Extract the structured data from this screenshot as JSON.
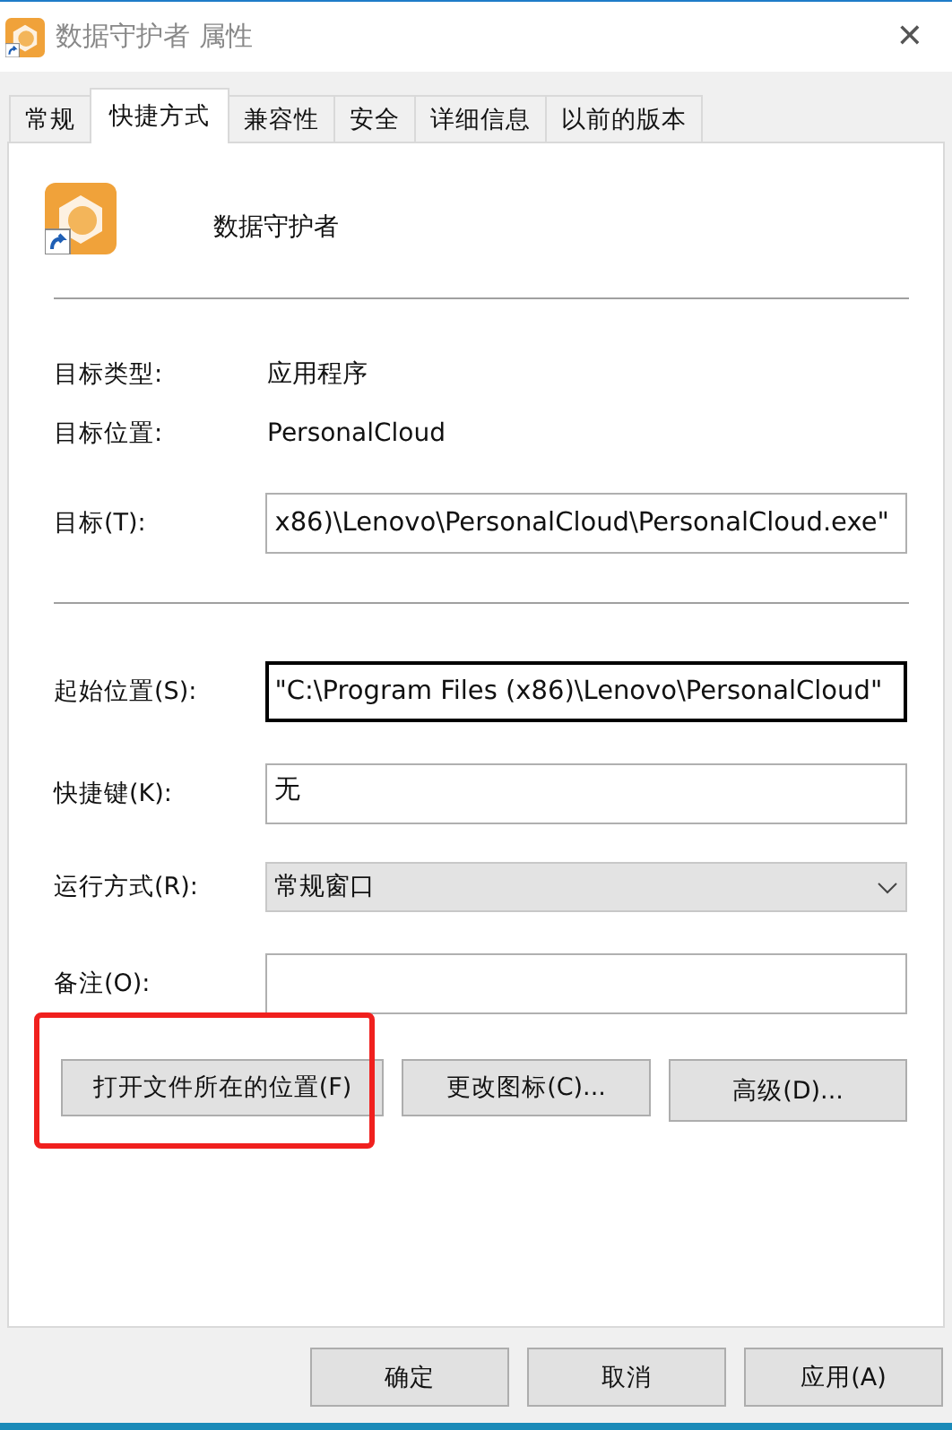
{
  "window": {
    "title": "数据守护者 属性",
    "close": "✕"
  },
  "tabs": [
    {
      "label": "常规",
      "selected": false
    },
    {
      "label": "快捷方式",
      "selected": true
    },
    {
      "label": "兼容性",
      "selected": false
    },
    {
      "label": "安全",
      "selected": false
    },
    {
      "label": "详细信息",
      "selected": false
    },
    {
      "label": "以前的版本",
      "selected": false
    }
  ],
  "shortcut": {
    "name": "数据守护者"
  },
  "info": [
    {
      "label": "目标类型:",
      "value": "应用程序"
    },
    {
      "label": "目标位置:",
      "value": "PersonalCloud"
    }
  ],
  "target": {
    "label": "目标(T):",
    "value": "x86)\\Lenovo\\PersonalCloud\\PersonalCloud.exe\""
  },
  "fields": [
    {
      "kind": "text",
      "label": "起始位置(S):",
      "value": "\"C:\\Program Files (x86)\\Lenovo\\PersonalCloud\"",
      "focused": true
    },
    {
      "kind": "text",
      "label": "快捷键(K):",
      "value": "无",
      "focused": false
    },
    {
      "kind": "select",
      "label": "运行方式(R):",
      "value": "常规窗口"
    },
    {
      "kind": "text",
      "label": "备注(O):",
      "focused": false
    }
  ],
  "actions": [
    {
      "label": "打开文件所在的位置(F)",
      "highlighted": true
    },
    {
      "label": "更改图标(C)...",
      "highlighted": false
    },
    {
      "label": "高级(D)...",
      "highlighted": false
    }
  ],
  "footer_buttons": [
    "确定",
    "取消",
    "应用(A)"
  ]
}
